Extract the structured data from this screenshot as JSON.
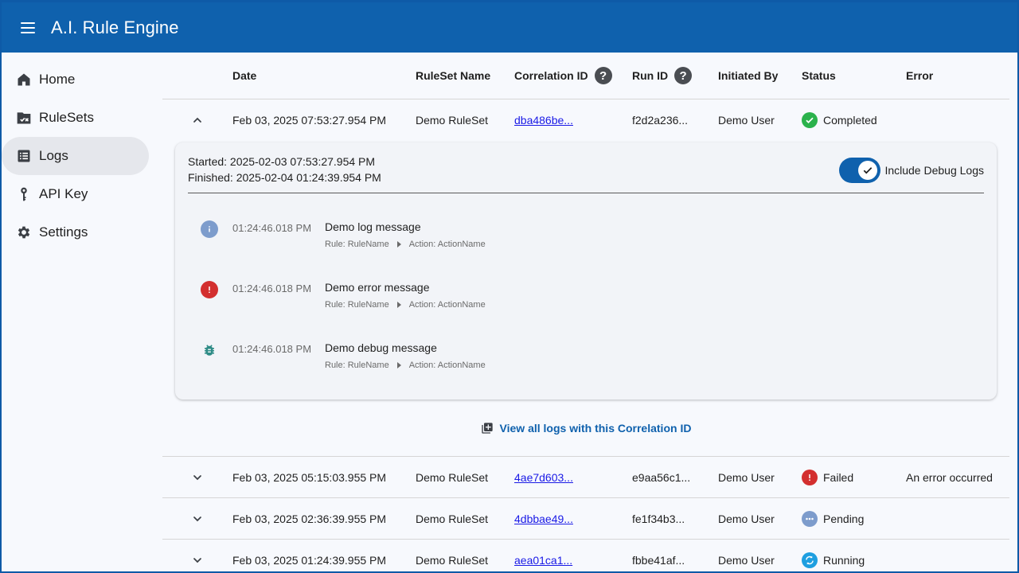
{
  "app": {
    "title": "A.I. Rule Engine"
  },
  "sidebar": {
    "items": [
      {
        "label": "Home",
        "icon": "home-icon"
      },
      {
        "label": "RuleSets",
        "icon": "rulesets-icon"
      },
      {
        "label": "Logs",
        "icon": "logs-icon",
        "active": true
      },
      {
        "label": "API Key",
        "icon": "key-icon"
      },
      {
        "label": "Settings",
        "icon": "gear-icon"
      }
    ]
  },
  "table": {
    "headers": {
      "date": "Date",
      "ruleset": "RuleSet Name",
      "correlation": "Correlation ID",
      "run": "Run ID",
      "initiated_by": "Initiated By",
      "status": "Status",
      "error": "Error"
    },
    "rows": [
      {
        "date": "Feb 03, 2025 07:53:27.954 PM",
        "ruleset": "Demo RuleSet",
        "correlation": "dba486be...",
        "run": "f2d2a236...",
        "by": "Demo User",
        "status": "Completed",
        "error": ""
      },
      {
        "date": "Feb 03, 2025 05:15:03.955 PM",
        "ruleset": "Demo RuleSet",
        "correlation": "4ae7d603...",
        "run": "e9aa56c1...",
        "by": "Demo User",
        "status": "Failed",
        "error": "An error occurred"
      },
      {
        "date": "Feb 03, 2025 02:36:39.955 PM",
        "ruleset": "Demo RuleSet",
        "correlation": "4dbbae49...",
        "run": "fe1f34b3...",
        "by": "Demo User",
        "status": "Pending",
        "error": ""
      },
      {
        "date": "Feb 03, 2025 01:24:39.955 PM",
        "ruleset": "Demo RuleSet",
        "correlation": "aea01ca1...",
        "run": "fbbe41af...",
        "by": "Demo User",
        "status": "Running",
        "error": ""
      }
    ]
  },
  "detail": {
    "started": "Started: 2025-02-03 07:53:27.954 PM",
    "finished": "Finished: 2025-02-04 01:24:39.954 PM",
    "debug_toggle_label": "Include Debug Logs",
    "debug_toggle_on": true,
    "logs": [
      {
        "level": "info",
        "time": "01:24:46.018 PM",
        "message": "Demo log message",
        "rule": "Rule: RuleName",
        "action": "Action: ActionName"
      },
      {
        "level": "error",
        "time": "01:24:46.018 PM",
        "message": "Demo error message",
        "rule": "Rule: RuleName",
        "action": "Action: ActionName"
      },
      {
        "level": "debug",
        "time": "01:24:46.018 PM",
        "message": "Demo debug message",
        "rule": "Rule: RuleName",
        "action": "Action: ActionName"
      }
    ],
    "view_all_label": "View all logs with this Correlation ID"
  },
  "colors": {
    "primary": "#0f61ad",
    "completed": "#2bb24c",
    "failed": "#d32f2f",
    "pending": "#7d9ccc",
    "running": "#1e9fe0",
    "debug": "#2e8b86",
    "link": "#1a1ae6"
  }
}
